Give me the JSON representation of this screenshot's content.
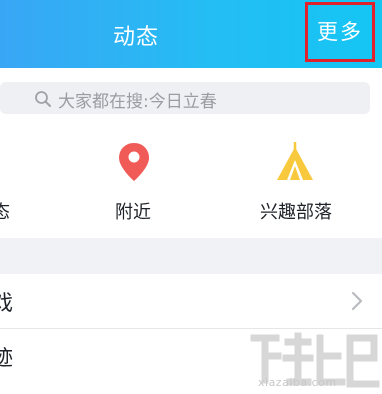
{
  "header": {
    "title": "动态",
    "more_label": "更多",
    "highlight_color": "#e0202a",
    "gradient": [
      "#39a6f5",
      "#14c6f3"
    ]
  },
  "search": {
    "placeholder": "大家都在搜:今日立春",
    "icon": "search-icon"
  },
  "quick_items": [
    {
      "label": "态",
      "icon": "partial-icon"
    },
    {
      "label": "附近",
      "icon": "location-pin-icon",
      "color": "#f05a57"
    },
    {
      "label": "兴趣部落",
      "icon": "tent-icon",
      "color": "#f9c93d"
    }
  ],
  "list": [
    {
      "label": "戏",
      "icon": "chevron-right-icon"
    },
    {
      "label": "迹"
    }
  ],
  "watermark": {
    "text": "xiazaiba.com"
  }
}
